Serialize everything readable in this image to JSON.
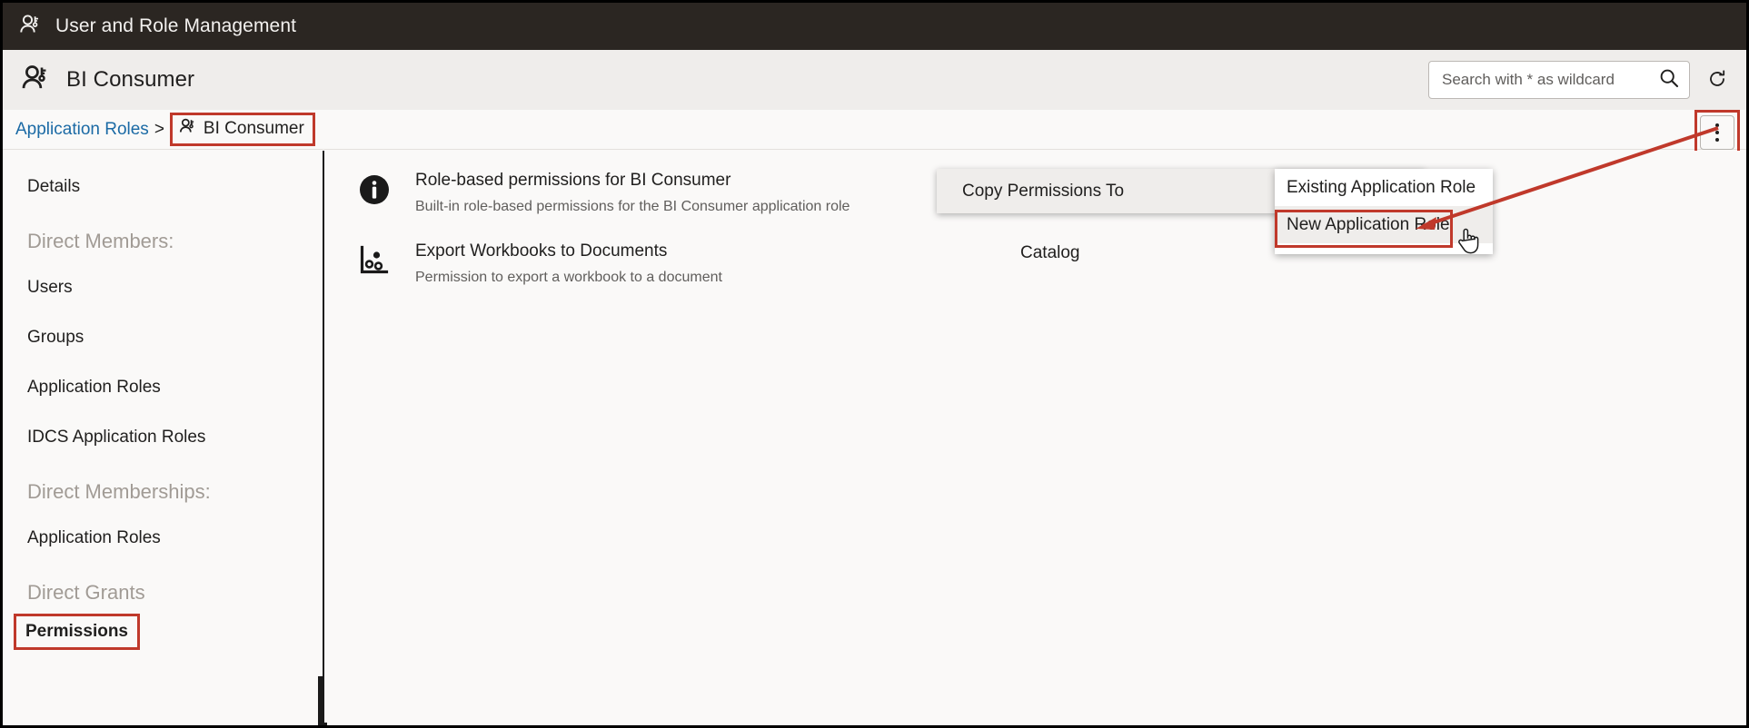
{
  "topbar": {
    "icon": "user-role-icon",
    "title": "User and Role Management"
  },
  "appheader": {
    "icon": "user-role-icon",
    "title": "BI Consumer",
    "search": {
      "placeholder": "Search with * as wildcard",
      "value": "",
      "icon": "search-icon"
    },
    "refresh": {
      "icon": "refresh-icon",
      "label": "Refresh"
    }
  },
  "breadcrumb": {
    "parent": "Application Roles",
    "separator": ">",
    "current": "BI Consumer",
    "current_icon": "user-role-icon",
    "highlight_color": "#c0392b"
  },
  "actions": {
    "kebab": {
      "icon": "more-vertical-icon",
      "label": "Actions"
    },
    "highlight_color": "#c0392b"
  },
  "sidebar": {
    "items": [
      {
        "label": "Details",
        "type": "item",
        "selected": false
      },
      {
        "label": "Direct Members:",
        "type": "group"
      },
      {
        "label": "Users",
        "type": "item",
        "selected": false
      },
      {
        "label": "Groups",
        "type": "item",
        "selected": false
      },
      {
        "label": "Application Roles",
        "type": "item",
        "selected": false
      },
      {
        "label": "IDCS Application Roles",
        "type": "item",
        "selected": false
      },
      {
        "label": "Direct Memberships:",
        "type": "group"
      },
      {
        "label": "Application Roles",
        "type": "item",
        "selected": false
      },
      {
        "label": "Direct Grants",
        "type": "group"
      },
      {
        "label": "Permissions",
        "type": "item",
        "selected": true
      }
    ]
  },
  "permissions": {
    "rows": [
      {
        "icon": "info-icon",
        "title": "Role-based permissions for BI Consumer",
        "description": "Built-in role-based permissions for the BI Consumer application role",
        "scope": ""
      },
      {
        "icon": "scatter-chart-icon",
        "title": "Export Workbooks to Documents",
        "description": "Permission to export a workbook to a document",
        "scope": "Catalog"
      }
    ]
  },
  "context_menu": {
    "parent": {
      "label": "Copy Permissions To",
      "caret": "caret-right-icon"
    },
    "submenu": {
      "items": [
        {
          "label": "Existing Application Role",
          "selected": false
        },
        {
          "label": "New Application Role",
          "selected": true
        }
      ],
      "highlight_color": "#c0392b"
    }
  },
  "annotation": {
    "color": "#c0392b",
    "cursor": "pointer-hand-cursor"
  }
}
